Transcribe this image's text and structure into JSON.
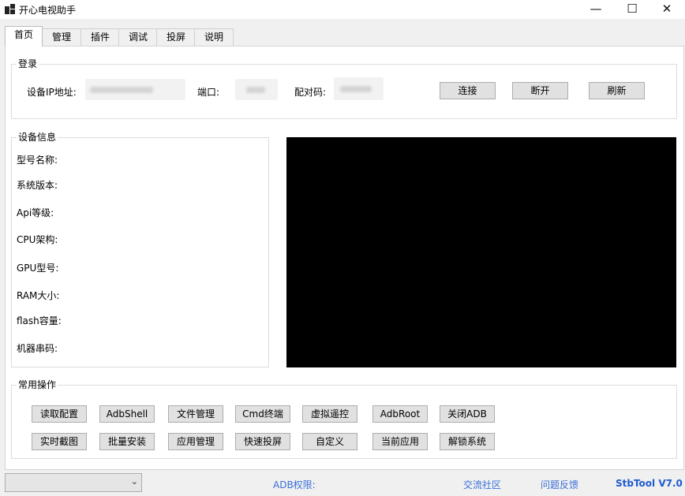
{
  "window": {
    "title": "开心电视助手",
    "minimize": "—",
    "maximize": "☐",
    "close": "✕"
  },
  "tabs": [
    "首页",
    "管理",
    "插件",
    "调试",
    "投屏",
    "说明"
  ],
  "login": {
    "title": "登录",
    "ip_label": "设备IP地址:",
    "port_label": "端口:",
    "pair_label": "配对码:",
    "connect": "连接",
    "disconnect": "断开",
    "refresh": "刷新"
  },
  "device_info": {
    "title": "设备信息",
    "fields": [
      "型号名称:",
      "系统版本:",
      "Api等级:",
      "CPU架构:",
      "GPU型号:",
      "RAM大小:",
      "flash容量:",
      "机器串码:"
    ]
  },
  "ops": {
    "title": "常用操作",
    "row1": [
      "读取配置",
      "AdbShell",
      "文件管理",
      "Cmd终端",
      "虚拟遥控",
      "AdbRoot",
      "关闭ADB"
    ],
    "row2": [
      "实时截图",
      "批量安装",
      "应用管理",
      "快速投屏",
      "自定义",
      "当前应用",
      "解锁系统"
    ]
  },
  "status": {
    "combo_value": "",
    "adb_label": "ADB权限:",
    "community": "交流社区",
    "feedback": "问题反馈",
    "version": "StbTool V7.0"
  },
  "colors": {
    "link": "#3a6fd8",
    "screen": "#000000"
  }
}
